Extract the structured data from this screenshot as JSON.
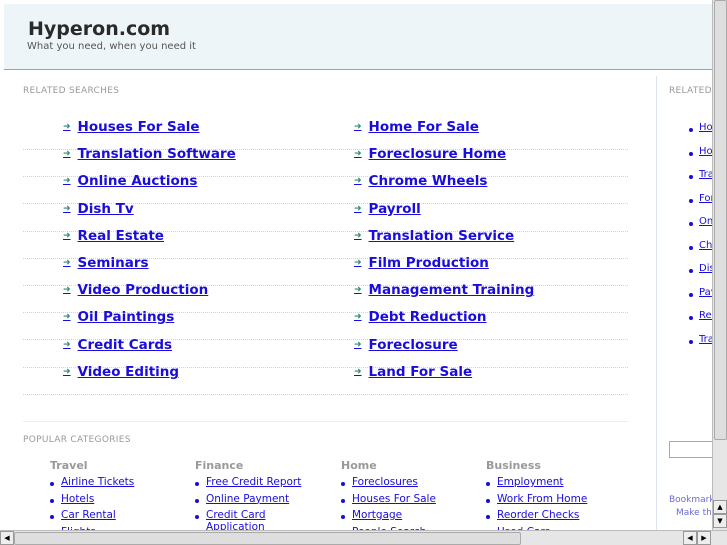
{
  "header": {
    "title": "Hyperon.com",
    "tagline": "What you need, when you need it"
  },
  "related": {
    "label": "RELATED SEARCHES",
    "left": [
      "Houses For Sale",
      "Translation Software",
      "Online Auctions",
      "Dish Tv",
      "Real Estate",
      "Seminars",
      "Video Production",
      "Oil Paintings",
      "Credit Cards",
      "Video Editing"
    ],
    "right": [
      "Home For Sale",
      "Foreclosure Home",
      "Chrome Wheels",
      "Payroll",
      "Translation Service",
      "Film Production",
      "Management Training",
      "Debt Reduction",
      "Foreclosure",
      "Land For Sale"
    ]
  },
  "sidebar": {
    "label": "RELATED",
    "items": [
      "Houses For Sale",
      "Home For Sale",
      "Translation Software",
      "Foreclosure Home",
      "Online Auctions",
      "Chrome Wheels",
      "Dish Tv",
      "Payroll",
      "Real Estate",
      "Translation Service"
    ],
    "bookmark": "Bookmark this page",
    "make": "Make this your homepage"
  },
  "popular": {
    "label": "POPULAR CATEGORIES",
    "columns": [
      {
        "title": "Travel",
        "items": [
          "Airline Tickets",
          "Hotels",
          "Car Rental",
          "Flights"
        ]
      },
      {
        "title": "Finance",
        "items": [
          "Free Credit Report",
          "Online Payment",
          "Credit Card Application"
        ]
      },
      {
        "title": "Home",
        "items": [
          "Foreclosures",
          "Houses For Sale",
          "Mortgage",
          "People Search"
        ]
      },
      {
        "title": "Business",
        "items": [
          "Employment",
          "Work From Home",
          "Reorder Checks",
          "Used Cars"
        ]
      }
    ]
  }
}
